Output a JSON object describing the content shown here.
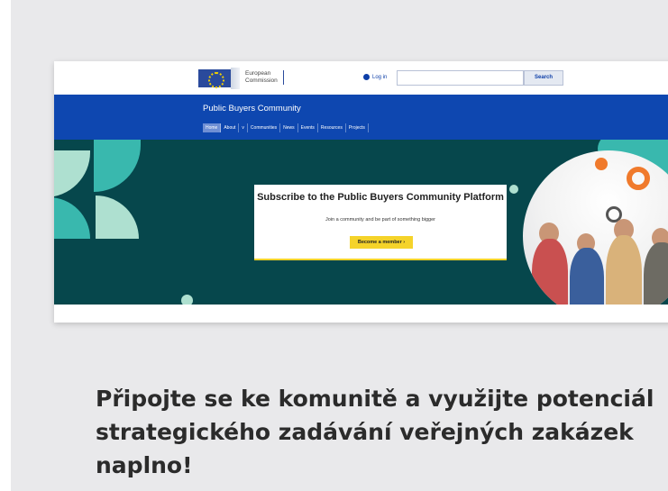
{
  "site": {
    "logo_text": "European\nCommission",
    "login_label": "Log in",
    "search_placeholder": "",
    "search_button": "Search",
    "title": "Public Buyers Community",
    "nav": [
      "Home",
      "About",
      "v",
      "Communities",
      "News",
      "Events",
      "Resources",
      "Projects"
    ],
    "active_nav": "Home"
  },
  "hero": {
    "card_title": "Subscribe to the Public Buyers Community Platform",
    "card_subtitle": "Join a community and be part of something bigger",
    "cta_label": "Become a member"
  },
  "caption": "Připojte se ke komunitě a využijte potenciál strategického zadávání veřejných zakázek naplno!",
  "colors": {
    "brand_blue": "#0e47b0",
    "hero_teal": "#06474c",
    "accent_yellow": "#f5d32a",
    "mint": "#aee0d0",
    "turquoise": "#39b8ae"
  }
}
